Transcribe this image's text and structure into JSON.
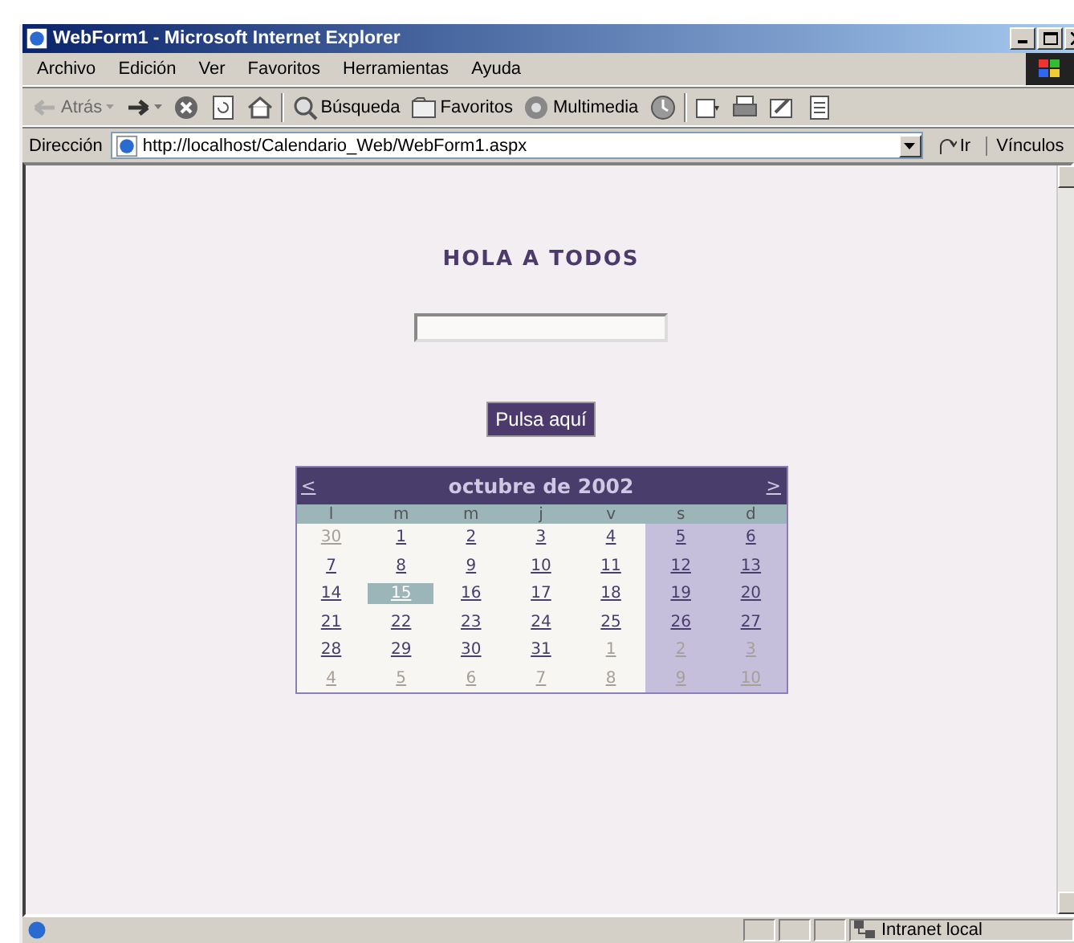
{
  "window": {
    "title": "WebForm1 - Microsoft Internet Explorer"
  },
  "menu": [
    "Archivo",
    "Edición",
    "Ver",
    "Favoritos",
    "Herramientas",
    "Ayuda"
  ],
  "toolbar": [
    {
      "kind": "back",
      "label": "Atrás",
      "disabled": true
    },
    {
      "kind": "forward",
      "disabled": false
    },
    {
      "kind": "stop",
      "disabled": false
    },
    {
      "kind": "refresh",
      "disabled": false
    },
    {
      "kind": "home",
      "disabled": false
    },
    {
      "kind": "search",
      "label": "Búsqueda",
      "disabled": false
    },
    {
      "kind": "favorites",
      "label": "Favoritos",
      "disabled": false
    },
    {
      "kind": "media",
      "label": "Multimedia",
      "disabled": false
    },
    {
      "kind": "history",
      "disabled": false
    },
    {
      "kind": "mail",
      "disabled": false
    },
    {
      "kind": "print",
      "disabled": false
    },
    {
      "kind": "edit",
      "disabled": false
    },
    {
      "kind": "discuss",
      "disabled": false
    }
  ],
  "address": {
    "label": "Dirección",
    "url": "http://localhost/Calendario_Web/WebForm1.aspx",
    "go": "Ir",
    "links": "Vínculos"
  },
  "page": {
    "heading": "HOLA A TODOS",
    "button": "Pulsa aquí"
  },
  "calendar": {
    "prev": "<",
    "title": "octubre de 2002",
    "next": ">",
    "day_names": [
      {
        "label": "l",
        "weekend": false
      },
      {
        "label": "m",
        "weekend": false
      },
      {
        "label": "m",
        "weekend": false
      },
      {
        "label": "j",
        "weekend": false
      },
      {
        "label": "v",
        "weekend": false
      },
      {
        "label": "s",
        "weekend": true
      },
      {
        "label": "d",
        "weekend": true
      }
    ],
    "weeks": [
      [
        {
          "day": "30",
          "other_month": true,
          "selected": false
        },
        {
          "day": "1",
          "other_month": false,
          "selected": false
        },
        {
          "day": "2",
          "other_month": false,
          "selected": false
        },
        {
          "day": "3",
          "other_month": false,
          "selected": false
        },
        {
          "day": "4",
          "other_month": false,
          "selected": false
        },
        {
          "day": "5",
          "other_month": false,
          "selected": false
        },
        {
          "day": "6",
          "other_month": false,
          "selected": false
        }
      ],
      [
        {
          "day": "7",
          "other_month": false,
          "selected": false
        },
        {
          "day": "8",
          "other_month": false,
          "selected": false
        },
        {
          "day": "9",
          "other_month": false,
          "selected": false
        },
        {
          "day": "10",
          "other_month": false,
          "selected": false
        },
        {
          "day": "11",
          "other_month": false,
          "selected": false
        },
        {
          "day": "12",
          "other_month": false,
          "selected": false
        },
        {
          "day": "13",
          "other_month": false,
          "selected": false
        }
      ],
      [
        {
          "day": "14",
          "other_month": false,
          "selected": false
        },
        {
          "day": "15",
          "other_month": false,
          "selected": true
        },
        {
          "day": "16",
          "other_month": false,
          "selected": false
        },
        {
          "day": "17",
          "other_month": false,
          "selected": false
        },
        {
          "day": "18",
          "other_month": false,
          "selected": false
        },
        {
          "day": "19",
          "other_month": false,
          "selected": false
        },
        {
          "day": "20",
          "other_month": false,
          "selected": false
        }
      ],
      [
        {
          "day": "21",
          "other_month": false,
          "selected": false
        },
        {
          "day": "22",
          "other_month": false,
          "selected": false
        },
        {
          "day": "23",
          "other_month": false,
          "selected": false
        },
        {
          "day": "24",
          "other_month": false,
          "selected": false
        },
        {
          "day": "25",
          "other_month": false,
          "selected": false
        },
        {
          "day": "26",
          "other_month": false,
          "selected": false
        },
        {
          "day": "27",
          "other_month": false,
          "selected": false
        }
      ],
      [
        {
          "day": "28",
          "other_month": false,
          "selected": false
        },
        {
          "day": "29",
          "other_month": false,
          "selected": false
        },
        {
          "day": "30",
          "other_month": false,
          "selected": false
        },
        {
          "day": "31",
          "other_month": false,
          "selected": false
        },
        {
          "day": "1",
          "other_month": true,
          "selected": false
        },
        {
          "day": "2",
          "other_month": true,
          "selected": false
        },
        {
          "day": "3",
          "other_month": true,
          "selected": false
        }
      ],
      [
        {
          "day": "4",
          "other_month": true,
          "selected": false
        },
        {
          "day": "5",
          "other_month": true,
          "selected": false
        },
        {
          "day": "6",
          "other_month": true,
          "selected": false
        },
        {
          "day": "7",
          "other_month": true,
          "selected": false
        },
        {
          "day": "8",
          "other_month": true,
          "selected": false
        },
        {
          "day": "9",
          "other_month": true,
          "selected": false
        },
        {
          "day": "10",
          "other_month": true,
          "selected": false
        }
      ]
    ]
  },
  "status_bar": {
    "zone": "Intranet local"
  }
}
